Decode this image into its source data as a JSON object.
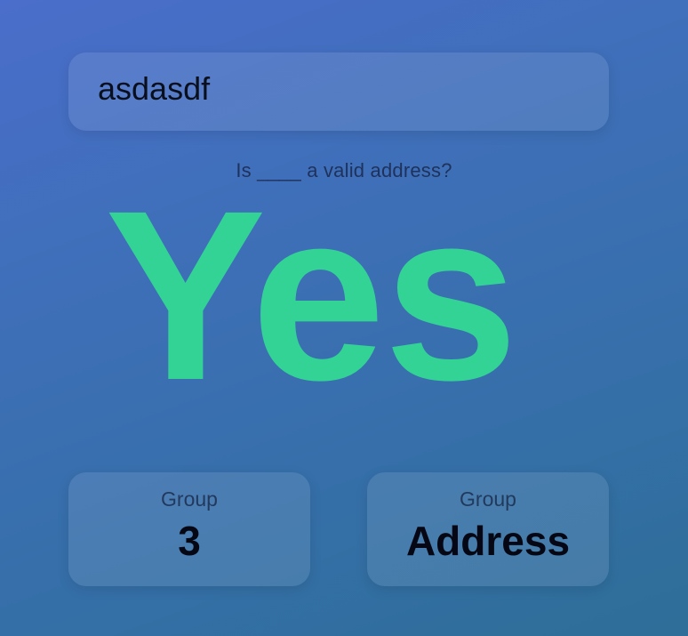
{
  "search": {
    "value": "asdasdf"
  },
  "question": {
    "text": "Is ____ a valid address?"
  },
  "answer": {
    "text": "Yes",
    "color": "#33d396"
  },
  "cards": [
    {
      "label": "Group",
      "value": "3"
    },
    {
      "label": "Group",
      "value": "Address"
    }
  ]
}
